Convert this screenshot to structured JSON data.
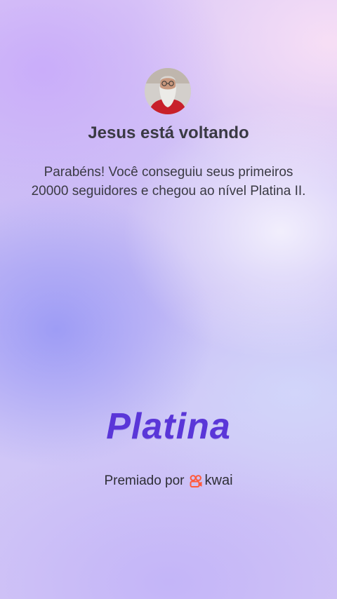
{
  "profile": {
    "avatar_icon": "user-avatar-icon",
    "username": "Jesus está voltando"
  },
  "message": "Parabéns! Você conseguiu seus primeiros 20000 seguidores e chegou ao nível Platina II.",
  "level": {
    "label": "Platina"
  },
  "award": {
    "prefix": "Premiado por",
    "brand_icon": "kwai-logo-icon",
    "brand_name": "kwai"
  },
  "colors": {
    "level_text": "#5a36d8",
    "brand_accent": "#ff5a3c",
    "text": "#3a3a44"
  }
}
